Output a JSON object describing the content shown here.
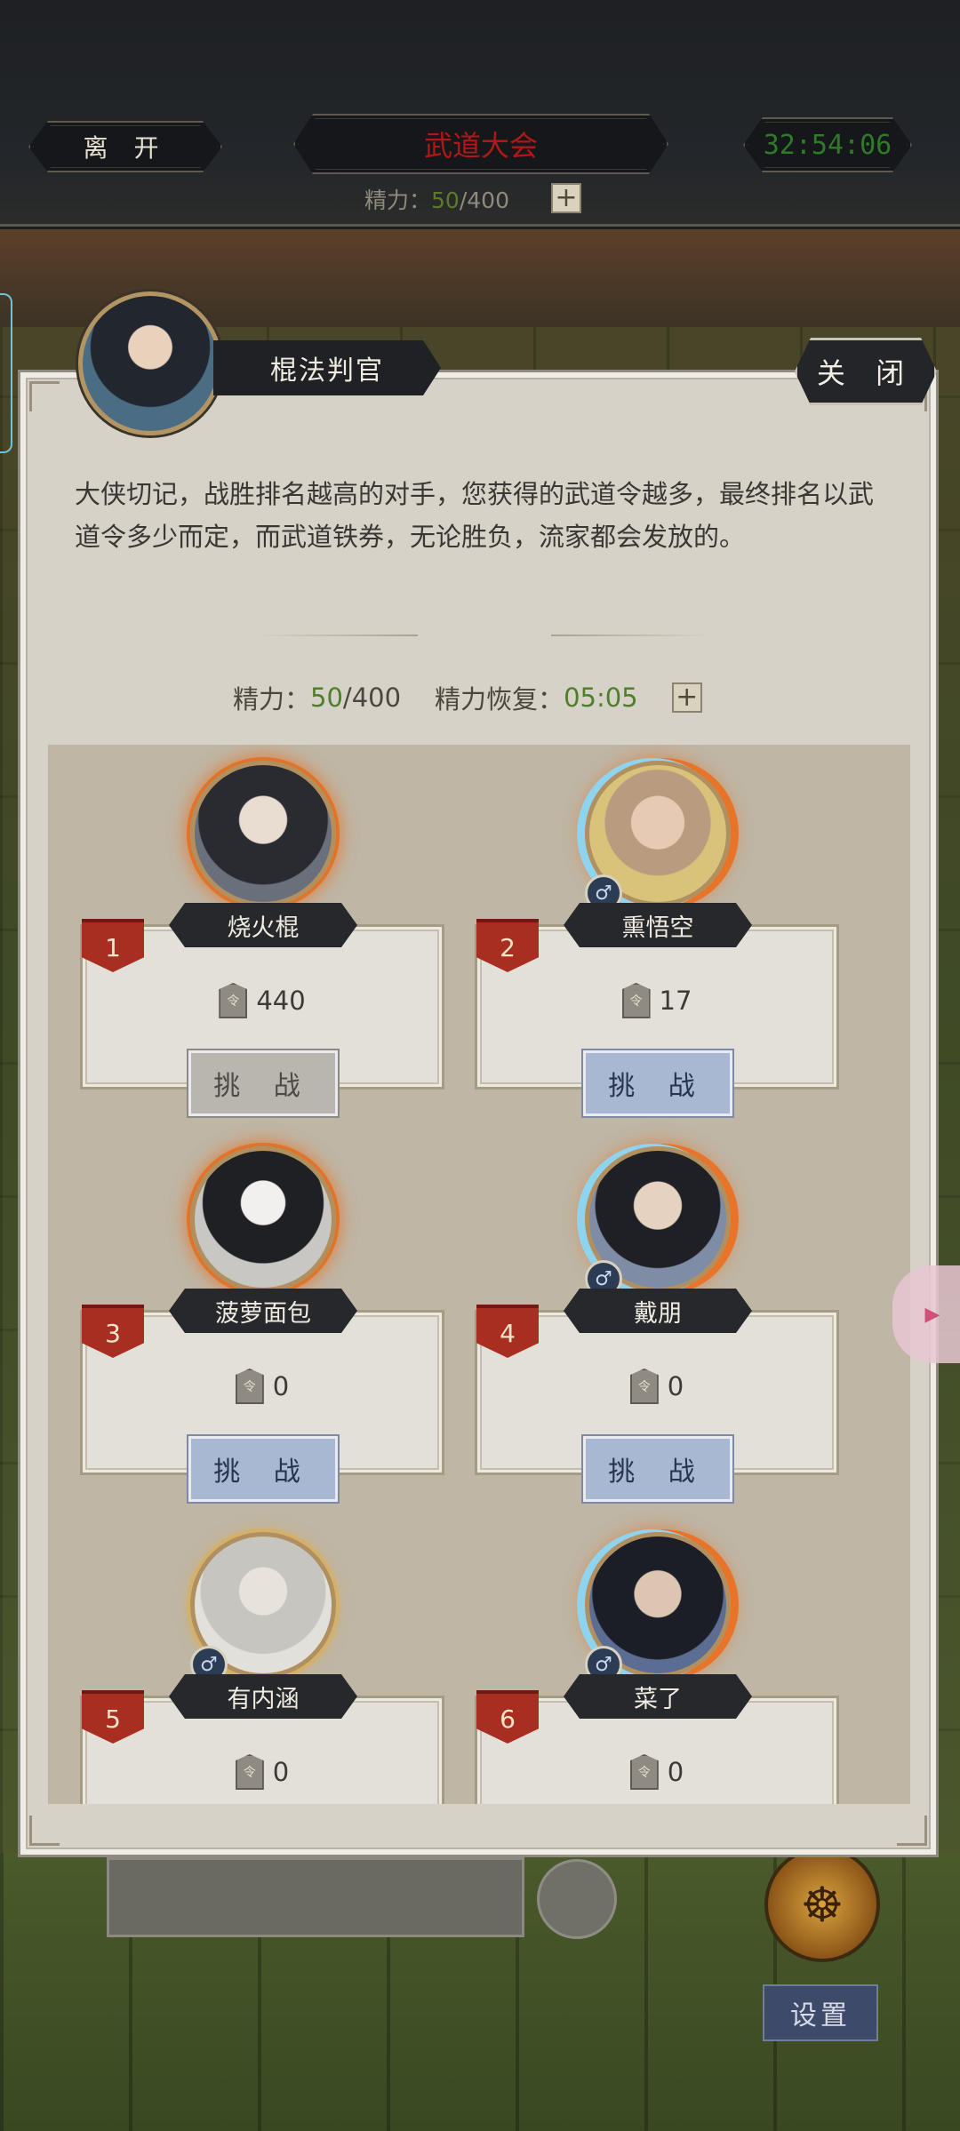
{
  "topbar": {
    "leave_label": "离 开",
    "title": "武道大会",
    "timer": "32:54:06",
    "energy_label": "精力：",
    "energy_current": "50",
    "energy_max": "/400",
    "plus": "+"
  },
  "npc": {
    "name": "棍法判官",
    "close_label": "关 闭",
    "description": "大侠切记，战胜排名越高的对手，您获得的武道令越多，最终排名以武道令多少而定，而武道铁券，无论胜负，流家都会发放的。"
  },
  "energy": {
    "label": "精力：",
    "current": "50",
    "max": "/400",
    "recover_label": "精力恢复：",
    "recover_time": "05:05",
    "plus": "+"
  },
  "opponents": [
    {
      "rank": "1",
      "name": "烧火棍",
      "tokens": "440",
      "challenge": "挑 战",
      "gender": "",
      "state": "disabled"
    },
    {
      "rank": "2",
      "name": "熏悟空",
      "tokens": "17",
      "challenge": "挑 战",
      "gender": "♂",
      "state": "active"
    },
    {
      "rank": "3",
      "name": "菠萝面包",
      "tokens": "0",
      "challenge": "挑 战",
      "gender": "",
      "state": "active"
    },
    {
      "rank": "4",
      "name": "戴朋",
      "tokens": "0",
      "challenge": "挑 战",
      "gender": "♂",
      "state": "active"
    },
    {
      "rank": "5",
      "name": "有内涵",
      "tokens": "0",
      "challenge": "",
      "gender": "♂",
      "state": "partial"
    },
    {
      "rank": "6",
      "name": "菜了",
      "tokens": "0",
      "challenge": "",
      "gender": "♂",
      "state": "partial"
    }
  ],
  "bottom": {
    "settings_label": "设置"
  },
  "colors": {
    "accent_red": "#a92e22",
    "energy_green": "#4e7f2a",
    "challenge_blue": "#a8b7d2",
    "timer_green": "#2f7a27",
    "title_red": "#b11717"
  },
  "icons": {
    "token": "token-icon",
    "male": "male-icon",
    "plus": "plus-icon"
  }
}
